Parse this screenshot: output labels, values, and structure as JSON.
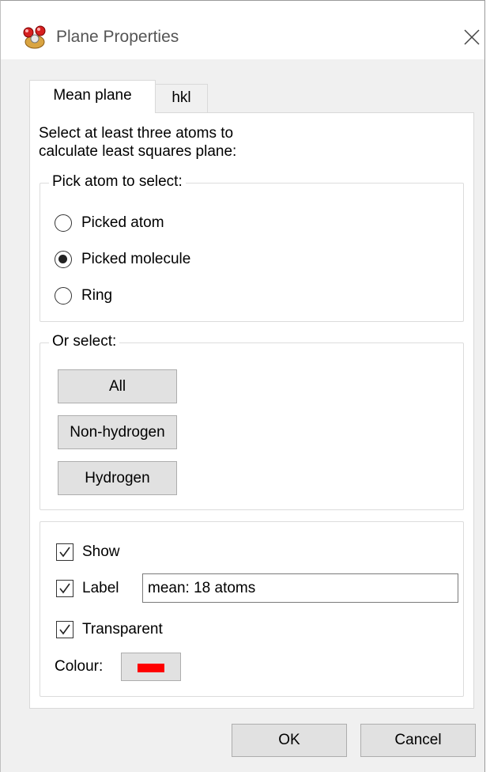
{
  "window": {
    "title": "Plane Properties"
  },
  "tabs": [
    {
      "label": "Mean plane",
      "active": true
    },
    {
      "label": "hkl",
      "active": false
    }
  ],
  "intro": {
    "line1": "Select at least three atoms to",
    "line2": "calculate least squares plane:"
  },
  "pick_group": {
    "legend": "Pick atom to select:",
    "options": [
      {
        "label": "Picked atom",
        "checked": false
      },
      {
        "label": "Picked molecule",
        "checked": true
      },
      {
        "label": "Ring",
        "checked": false
      }
    ]
  },
  "select_group": {
    "legend": "Or select:",
    "buttons": [
      "All",
      "Non-hydrogen",
      "Hydrogen"
    ]
  },
  "options": {
    "show_label": "Show",
    "show_checked": true,
    "label_label": "Label",
    "label_checked": true,
    "label_value": "mean: 18 atoms",
    "transparent_label": "Transparent",
    "transparent_checked": true,
    "colour_label": "Colour:",
    "colour_value": "#ff0000"
  },
  "footer": {
    "ok_label": "OK",
    "cancel_label": "Cancel"
  },
  "icons": {
    "app": "molecule-app-icon",
    "close": "close-icon"
  }
}
